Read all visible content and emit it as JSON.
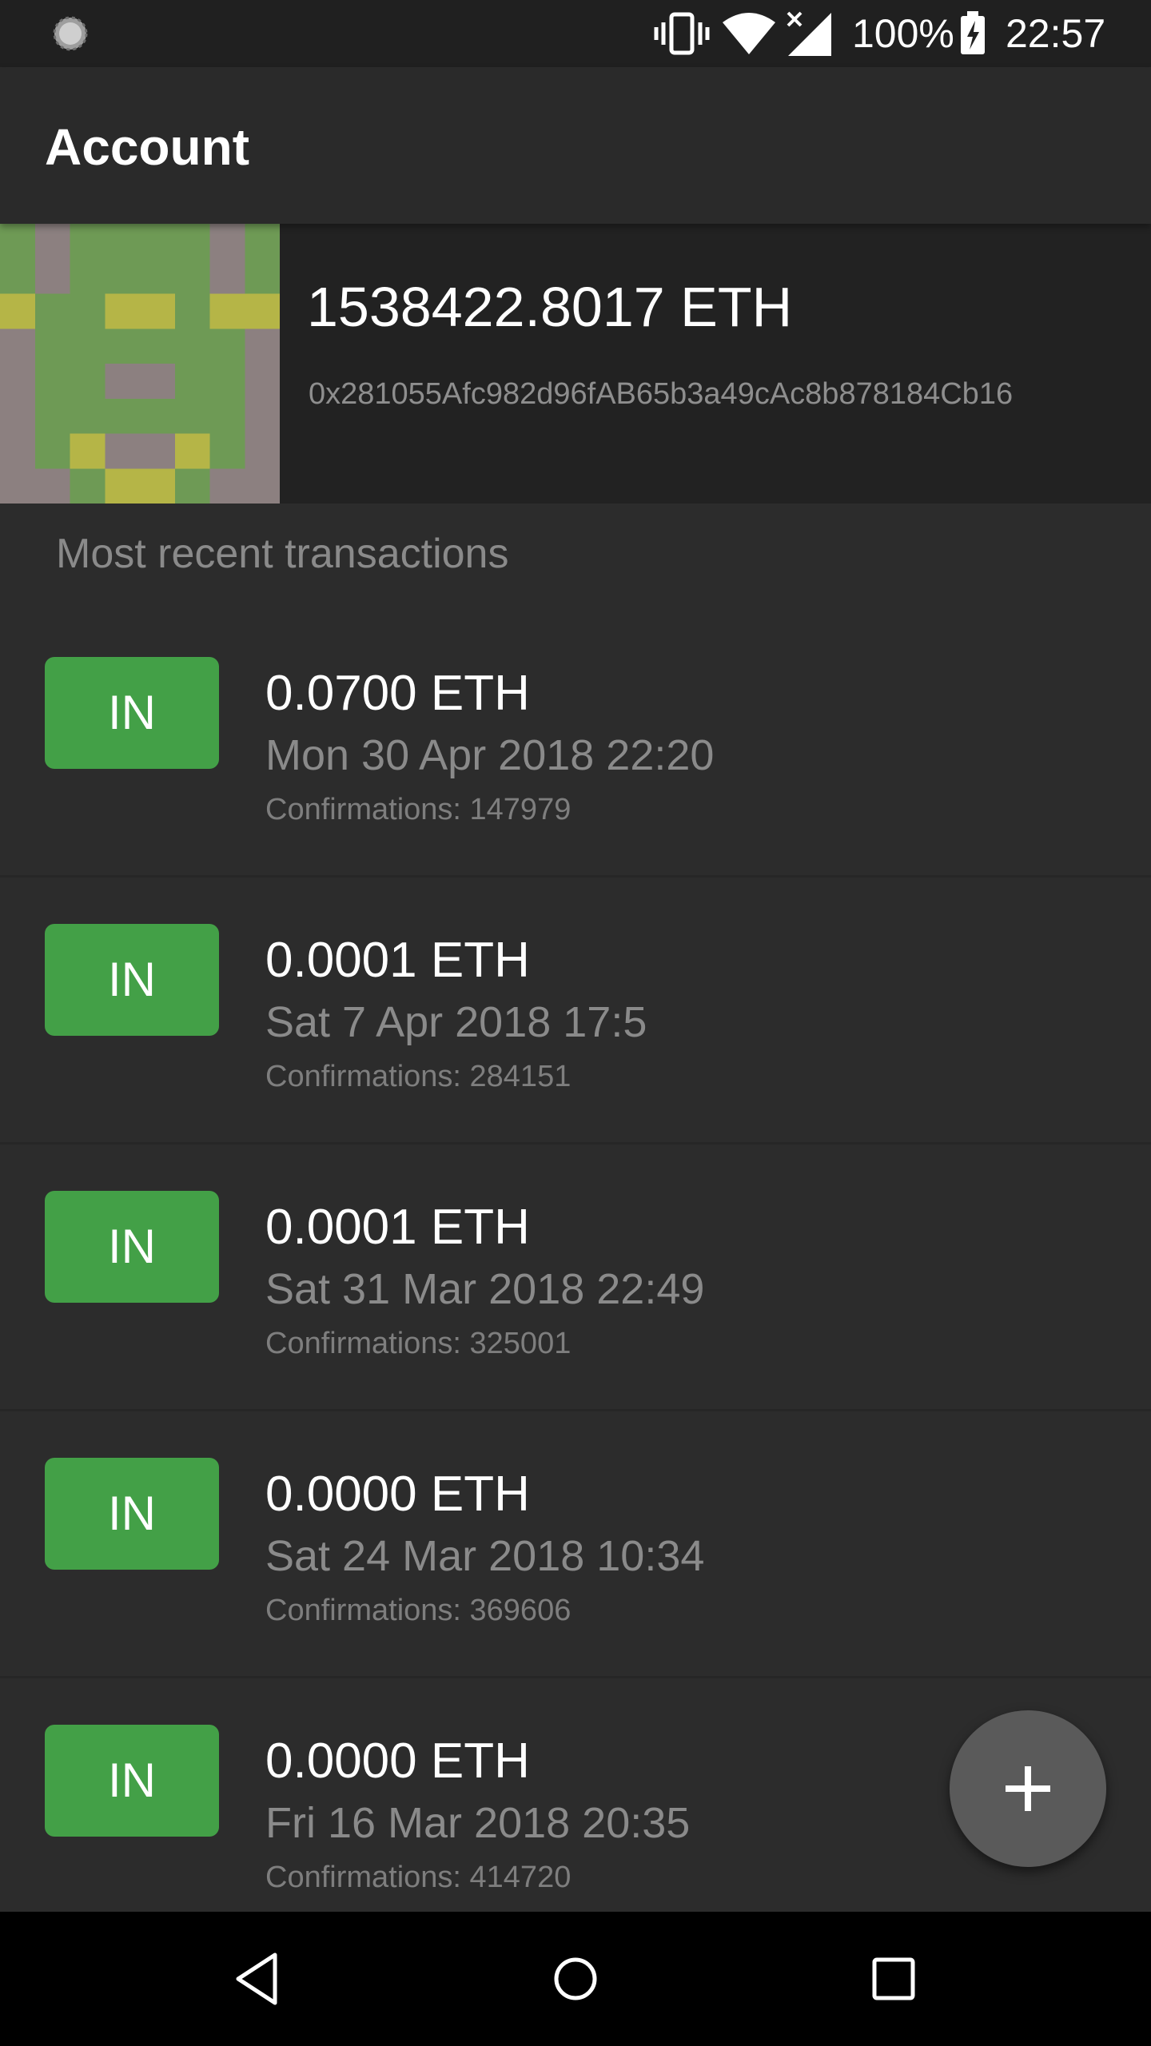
{
  "status_bar": {
    "battery_percent": "100%",
    "time": "22:57",
    "icons": [
      "loading-spinner-icon",
      "vibrate-icon",
      "wifi-icon",
      "no-signal-icon",
      "battery-charging-icon"
    ]
  },
  "app_bar": {
    "title": "Account"
  },
  "account": {
    "balance": "1538422.8017 ETH",
    "address": "0x281055Afc982d96fAB65b3a49cAc8b878184Cb16"
  },
  "transactions_section": {
    "header": "Most recent transactions"
  },
  "transactions": [
    {
      "direction": "IN",
      "amount": "0.0700 ETH",
      "date": "Mon 30 Apr 2018 22:20",
      "confirmations": "Confirmations: 147979"
    },
    {
      "direction": "IN",
      "amount": "0.0001 ETH",
      "date": "Sat 7 Apr 2018 17:5",
      "confirmations": "Confirmations: 284151"
    },
    {
      "direction": "IN",
      "amount": "0.0001 ETH",
      "date": "Sat 31 Mar 2018 22:49",
      "confirmations": "Confirmations: 325001"
    },
    {
      "direction": "IN",
      "amount": "0.0000 ETH",
      "date": "Sat 24 Mar 2018 10:34",
      "confirmations": "Confirmations: 369606"
    },
    {
      "direction": "IN",
      "amount": "0.0000 ETH",
      "date": "Fri 16 Mar 2018 20:35",
      "confirmations": "Confirmations: 414720"
    }
  ],
  "fab": {
    "icon": "plus-icon"
  },
  "nav_bar": {
    "icons": [
      "back-icon",
      "home-icon",
      "recents-icon"
    ]
  },
  "colors": {
    "in_badge": "#43a047",
    "background": "#2c2c2c",
    "app_bar": "#2a2a2a",
    "account_card": "#222222",
    "fab": "#5a5a5a"
  }
}
